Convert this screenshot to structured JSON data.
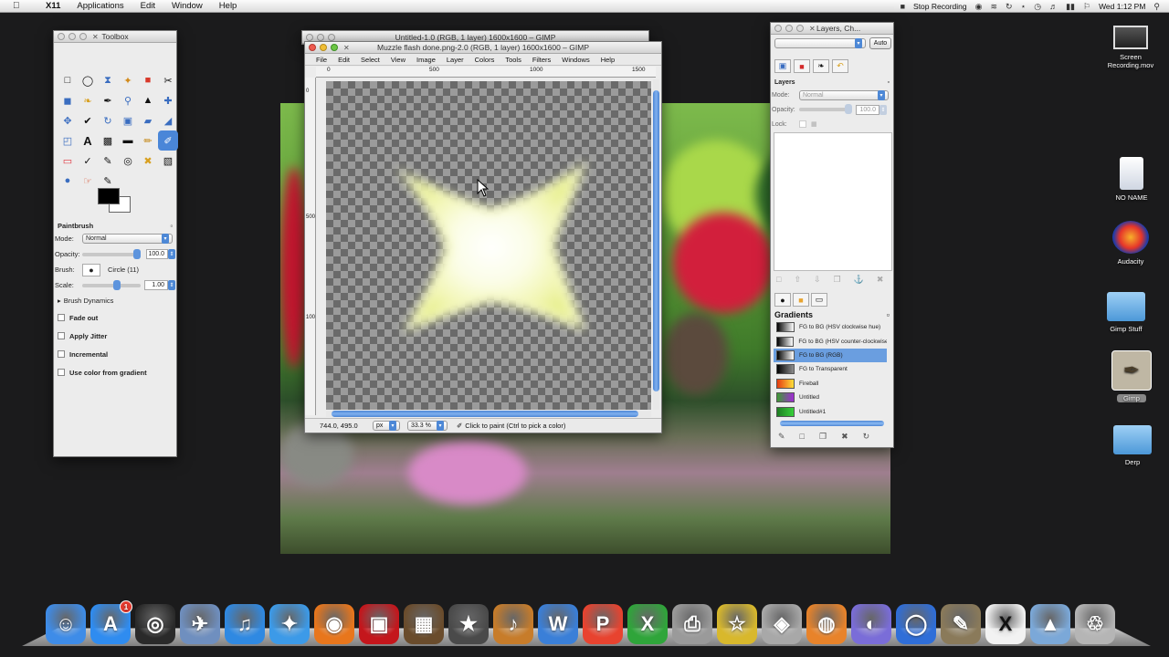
{
  "menubar": {
    "apple": "",
    "app": "X11",
    "items": [
      "Applications",
      "Edit",
      "Window",
      "Help"
    ],
    "stop_recording": "Stop Recording",
    "clock": "Wed 1:12 PM"
  },
  "toolbox": {
    "title": "Toolbox",
    "fg_color": "#000000",
    "bg_color": "#ffffff",
    "options_title": "Paintbrush",
    "mode_label": "Mode:",
    "mode_value": "Normal",
    "opacity_label": "Opacity:",
    "opacity_value": "100.0",
    "opacity_level": 1.0,
    "brush_label": "Brush:",
    "brush_value": "Circle (11)",
    "scale_label": "Scale:",
    "scale_value": "1.00",
    "dynamics_label": "Brush Dynamics",
    "fade_out": "Fade out",
    "apply_jitter": "Apply Jitter",
    "incremental": "Incremental",
    "use_gradient": "Use color from gradient"
  },
  "image_window_back": {
    "title": "Untitled-1.0 (RGB, 1 layer) 1600x1600 – GIMP"
  },
  "image_window": {
    "title": "Muzzle flash done.png-2.0 (RGB, 1 layer) 1600x1600 – GIMP",
    "menu": [
      "File",
      "Edit",
      "Select",
      "View",
      "Image",
      "Layer",
      "Colors",
      "Tools",
      "Filters",
      "Windows",
      "Help"
    ],
    "ruler_top": [
      "0",
      "500",
      "1000",
      "1500"
    ],
    "ruler_left": [
      "0",
      "500",
      "1000"
    ],
    "coords": "744.0, 495.0",
    "unit": "px",
    "zoom": "33.3 %",
    "status": "Click to paint (Ctrl to pick a color)"
  },
  "layers_dock": {
    "title": "Layers, Ch...",
    "auto_label": "Auto",
    "layers_title": "Layers",
    "mode_label": "Mode:",
    "mode_value": "Normal",
    "opacity_label": "Opacity:",
    "opacity_value": "100.0",
    "lock_label": "Lock:",
    "gradients_title": "Gradients",
    "gradients": [
      {
        "name": "FG to BG (HSV clockwise hue)",
        "colors": [
          "#000000",
          "#ffffff"
        ]
      },
      {
        "name": "FG to BG (HSV counter-clockwise)",
        "colors": [
          "#000000",
          "#ffffff"
        ]
      },
      {
        "name": "FG to BG (RGB)",
        "colors": [
          "#000000",
          "#ffffff"
        ],
        "selected": true
      },
      {
        "name": "FG to Transparent",
        "colors": [
          "#000000",
          "#8e8e8e"
        ]
      },
      {
        "name": "Fireball",
        "colors": [
          "#e53b12",
          "#ffdf3a"
        ]
      },
      {
        "name": "Untitled",
        "colors": [
          "#3d9b32",
          "#a02bd6"
        ]
      },
      {
        "name": "Untitled#1",
        "colors": [
          "#1e7d23",
          "#37d03a"
        ]
      }
    ]
  },
  "desktop": {
    "icons": [
      {
        "label": "Screen Recording.mov"
      },
      {
        "label": "NO NAME"
      },
      {
        "label": "Audacity"
      },
      {
        "label": "Gimp Stuff"
      },
      {
        "label": "Gimp"
      },
      {
        "label": "Derp"
      }
    ]
  },
  "dock": {
    "items": [
      {
        "name": "finder",
        "glyph": "☺",
        "color": "#3e8ce8"
      },
      {
        "name": "app-store",
        "glyph": "A",
        "color": "#2f8cf0",
        "badge": "1"
      },
      {
        "name": "dashboard",
        "glyph": "◎",
        "color": "#2a2a2a"
      },
      {
        "name": "preview",
        "glyph": "✈",
        "color": "#6f8fbf"
      },
      {
        "name": "itunes",
        "glyph": "♫",
        "color": "#2f89e2"
      },
      {
        "name": "safari",
        "glyph": "✦",
        "color": "#3c9ae8"
      },
      {
        "name": "firefox",
        "glyph": "◉",
        "color": "#e8761c"
      },
      {
        "name": "photo-booth",
        "glyph": "▣",
        "color": "#c4161c"
      },
      {
        "name": "iphoto",
        "glyph": "▦",
        "color": "#6a4c2c"
      },
      {
        "name": "imovie",
        "glyph": "★",
        "color": "#4a4a4a"
      },
      {
        "name": "garageband",
        "glyph": "♪",
        "color": "#c77c2a"
      },
      {
        "name": "word",
        "glyph": "W",
        "color": "#3a7fd8"
      },
      {
        "name": "powerpoint",
        "glyph": "P",
        "color": "#e8432f"
      },
      {
        "name": "excel",
        "glyph": "X",
        "color": "#2fa53a"
      },
      {
        "name": "printer",
        "glyph": "⎙",
        "color": "#9a9a9a"
      },
      {
        "name": "star-app",
        "glyph": "☆",
        "color": "#d8b82c"
      },
      {
        "name": "image-capture",
        "glyph": "◈",
        "color": "#a8a8a8"
      },
      {
        "name": "blender",
        "glyph": "◍",
        "color": "#e8832a"
      },
      {
        "name": "color-wheel",
        "glyph": "◐",
        "color": "#7a6dd8"
      },
      {
        "name": "network-globe",
        "glyph": "◯",
        "color": "#2f6ed8"
      },
      {
        "name": "gimp",
        "glyph": "✎",
        "color": "#8a7a5a"
      },
      {
        "name": "x11",
        "glyph": "X",
        "color": "#f2f2f2"
      },
      {
        "name": "applications-folder",
        "glyph": "▲",
        "color": "#7ba8d8"
      },
      {
        "name": "trash",
        "glyph": "♲",
        "color": "#b5b5b5"
      }
    ]
  }
}
